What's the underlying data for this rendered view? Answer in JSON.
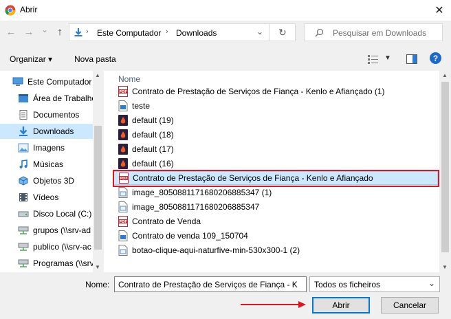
{
  "window": {
    "title": "Abrir",
    "close_glyph": "✕"
  },
  "nav": {
    "back_glyph": "←",
    "forward_glyph": "→",
    "recent_glyph": "⌄",
    "up_glyph": "↑",
    "refresh_glyph": "↻",
    "breadcrumb": [
      "Este Computador",
      "Downloads"
    ],
    "breadcrumb_sep": "›",
    "search_placeholder": "Pesquisar em Downloads"
  },
  "toolbar": {
    "organize_label": "Organizar ▾",
    "new_folder_label": "Nova pasta",
    "help_glyph": "?"
  },
  "tree": [
    {
      "label": "Este Computador",
      "icon": "computer-icon"
    },
    {
      "label": "Área de Trabalho",
      "icon": "desktop-icon"
    },
    {
      "label": "Documentos",
      "icon": "documents-icon"
    },
    {
      "label": "Downloads",
      "icon": "downloads-icon",
      "selected": true
    },
    {
      "label": "Imagens",
      "icon": "images-icon"
    },
    {
      "label": "Músicas",
      "icon": "music-icon"
    },
    {
      "label": "Objetos 3D",
      "icon": "objects3d-icon"
    },
    {
      "label": "Vídeos",
      "icon": "videos-icon"
    },
    {
      "label": "Disco Local (C:)",
      "icon": "drive-icon"
    },
    {
      "label": "grupos (\\\\srv-ad",
      "icon": "network-drive-icon"
    },
    {
      "label": "publico (\\\\srv-ac",
      "icon": "network-drive-icon"
    },
    {
      "label": "Programas (\\\\srv",
      "icon": "network-drive-icon"
    }
  ],
  "files": {
    "column_header": "Nome",
    "items": [
      {
        "name": "Contrato de Prestação de Serviços de Fiança - Kenlo e Afiançado (1)",
        "icon": "pdf-icon"
      },
      {
        "name": "teste",
        "icon": "document-icon"
      },
      {
        "name": "default (19)",
        "icon": "adobe-icon"
      },
      {
        "name": "default (18)",
        "icon": "adobe-icon"
      },
      {
        "name": "default (17)",
        "icon": "adobe-icon"
      },
      {
        "name": "default (16)",
        "icon": "adobe-icon"
      },
      {
        "name": "Contrato de Prestação de Serviços de Fiança - Kenlo e Afiançado",
        "icon": "pdf-icon",
        "selected": true
      },
      {
        "name": "image_8050881171680206885347 (1)",
        "icon": "image-file-icon"
      },
      {
        "name": "image_8050881171680206885347",
        "icon": "image-file-icon"
      },
      {
        "name": "Contrato de Venda",
        "icon": "pdf-icon"
      },
      {
        "name": "Contrato de venda 109_150704",
        "icon": "document-icon"
      },
      {
        "name": "botao-clique-aqui-naturfive-min-530x300-1 (2)",
        "icon": "image-file-icon"
      }
    ]
  },
  "footer": {
    "filename_label": "Nome:",
    "filename_value": "Contrato de Prestação de Serviços de Fiança - K",
    "filetype_value": "Todos os ficheiros",
    "open_label": "Abrir",
    "cancel_label": "Cancelar"
  },
  "colors": {
    "selection": "#cce8ff",
    "highlight_box": "#e0141e",
    "arrow": "#e0141e",
    "accent": "#0078d7"
  }
}
